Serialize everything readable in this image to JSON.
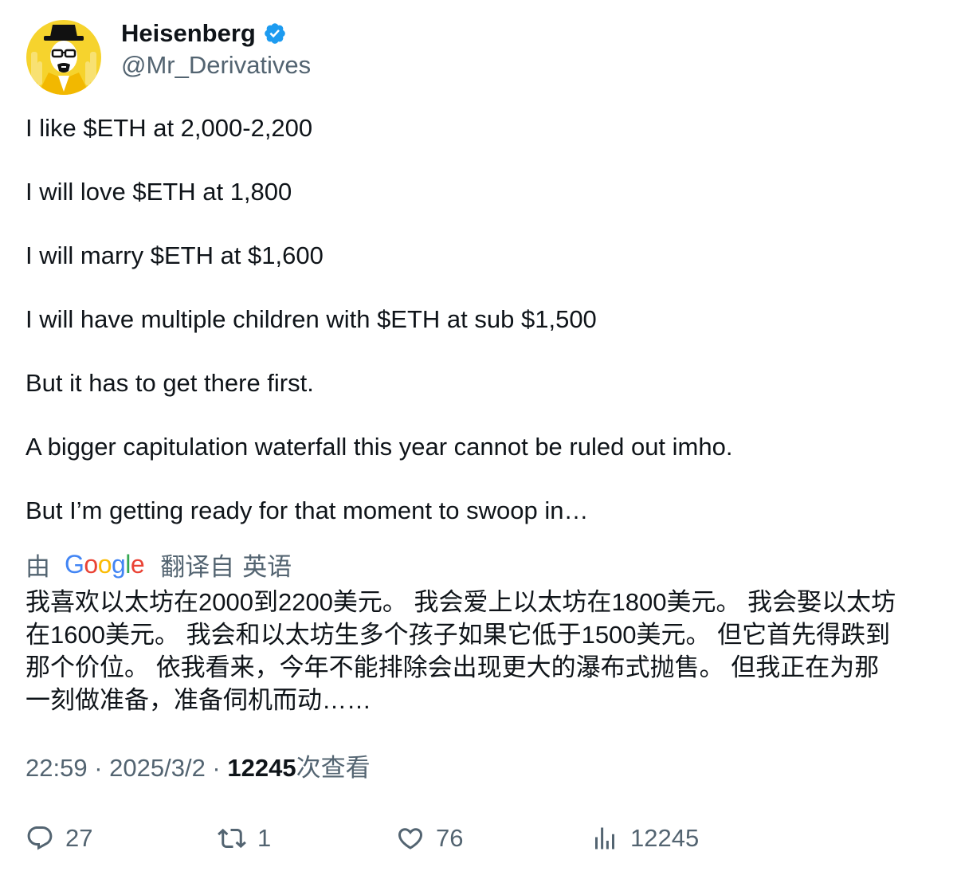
{
  "author": {
    "display_name": "Heisenberg",
    "handle": "@Mr_Derivatives",
    "verified_icon": "verified-badge-icon",
    "avatar": "heisenberg-avatar"
  },
  "tweet": {
    "lines": [
      "I like $ETH at 2,000-2,200",
      "I will love $ETH at 1,800",
      "I will marry $ETH at $1,600",
      "I will have multiple children with $ETH at sub $1,500",
      "But it has to get there first.",
      "A bigger capitulation waterfall this year cannot be ruled out imho.",
      "But I’m getting ready for that moment to swoop in…"
    ]
  },
  "translation": {
    "by_label": "由",
    "provider": "Google",
    "from_label": "翻译自",
    "language": "英语",
    "lines": [
      "我喜欢以太坊在2000到2200美元。 我会爱上以太坊在1800美元。 我会娶以太坊",
      "在1600美元。 我会和以太坊生多个孩子如果它低于1500美元。 但它首先得跌到",
      "那个价位。 依我看来，今年不能排除会出现更大的瀑布式抛售。 但我正在为那",
      "一刻做准备，准备伺机而动……"
    ]
  },
  "meta": {
    "time": "22:59",
    "separator": " · ",
    "date": "2025/3/2",
    "views": "12245",
    "views_suffix": "次查看"
  },
  "actions": {
    "replies": "27",
    "retweets": "1",
    "likes": "76",
    "views": "12245"
  },
  "colors": {
    "text_primary": "#0f1419",
    "text_secondary": "#536471",
    "verified_blue": "#1d9bf0"
  }
}
